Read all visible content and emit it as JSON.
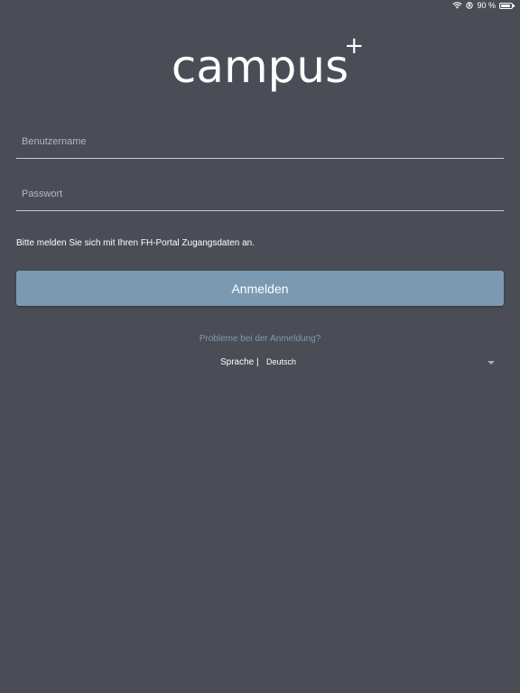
{
  "status_bar": {
    "battery_text": "90 %",
    "battery_level": 0.9
  },
  "logo": {
    "word": "campus",
    "plus": "+"
  },
  "form": {
    "username_placeholder": "Benutzername",
    "username_value": "",
    "password_placeholder": "Passwort",
    "password_value": "",
    "hint": "Bitte melden Sie sich mit Ihren FH-Portal Zugangsdaten an.",
    "login_label": "Anmelden"
  },
  "help": {
    "problems_link": "Probleme bei der Anmeldung?"
  },
  "language": {
    "label": "Sprache |",
    "selected": "Deutsch"
  },
  "colors": {
    "background": "#4a4d55",
    "button": "#7b9ab2",
    "link": "#7f9ab0"
  }
}
